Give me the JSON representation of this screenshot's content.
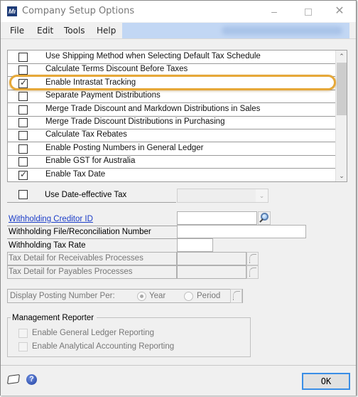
{
  "window": {
    "title": "Company Setup Options",
    "app_icon": "dynamics-gp-logo-icon",
    "controls": {
      "minimize": "–",
      "maximize": "□",
      "close": "✕"
    }
  },
  "menu": [
    {
      "label": "File"
    },
    {
      "label": "Edit"
    },
    {
      "label": "Tools"
    },
    {
      "label": "Help"
    }
  ],
  "options_list": {
    "items": [
      {
        "label": "Use Shipping Method when Selecting Default Tax Schedule",
        "checked": false
      },
      {
        "label": "Calculate Terms Discount Before Taxes",
        "checked": false
      },
      {
        "label": "Enable Intrastat Tracking",
        "checked": true,
        "highlighted": true
      },
      {
        "label": "Separate Payment Distributions",
        "checked": false
      },
      {
        "label": "Merge Trade Discount and Markdown Distributions in Sales",
        "checked": false
      },
      {
        "label": "Merge Trade Discount Distributions in Purchasing",
        "checked": false
      },
      {
        "label": "Calculate Tax Rebates",
        "checked": false
      },
      {
        "label": "Enable Posting Numbers in General Ledger",
        "checked": false
      },
      {
        "label": "Enable GST for Australia",
        "checked": false
      },
      {
        "label": "Enable Tax Date",
        "checked": true
      }
    ],
    "scroll_up": "⌃",
    "scroll_down": "⌄",
    "highlight_color": "#e6a838"
  },
  "date_effective": {
    "label": "Use Date-effective Tax",
    "checked": false,
    "dropdown_value": "",
    "dropdown_arrow": "⌄"
  },
  "fields": {
    "withholding_creditor_id": {
      "label": "Withholding Creditor ID",
      "value": ""
    },
    "withholding_file_number": {
      "label": "Withholding File/Reconciliation Number",
      "value": ""
    },
    "withholding_tax_rate": {
      "label": "Withholding Tax Rate",
      "value": ""
    },
    "tax_detail_receivables": {
      "label": "Tax Detail for Receivables Processes",
      "value": ""
    },
    "tax_detail_payables": {
      "label": "Tax Detail for Payables Processes",
      "value": ""
    }
  },
  "posting_number": {
    "label": "Display Posting Number Per:",
    "options": [
      {
        "label": "Year",
        "selected": true
      },
      {
        "label": "Period",
        "selected": false
      }
    ]
  },
  "management_reporter": {
    "title": "Management Reporter",
    "items": [
      {
        "label": "Enable General Ledger Reporting",
        "checked": false
      },
      {
        "label": "Enable Analytical Accounting Reporting",
        "checked": false
      }
    ]
  },
  "footer": {
    "help_glyph": "?",
    "ok_label": "OK"
  }
}
